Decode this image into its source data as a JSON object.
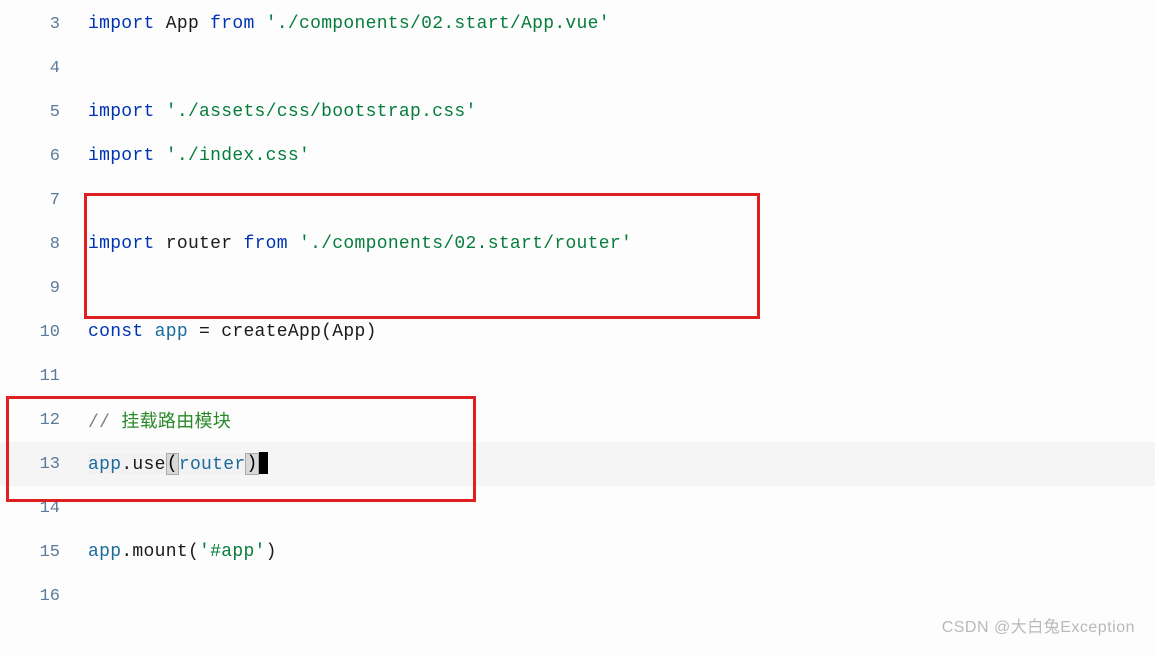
{
  "lines": [
    {
      "num": "3",
      "tokens": [
        {
          "t": "import",
          "c": "tok-keyword"
        },
        {
          "t": " ",
          "c": "tok-default"
        },
        {
          "t": "App",
          "c": "tok-default"
        },
        {
          "t": " ",
          "c": "tok-default"
        },
        {
          "t": "from",
          "c": "tok-keyword"
        },
        {
          "t": " ",
          "c": "tok-default"
        },
        {
          "t": "'./components/02.start/App.vue'",
          "c": "tok-string"
        }
      ]
    },
    {
      "num": "4",
      "tokens": []
    },
    {
      "num": "5",
      "tokens": [
        {
          "t": "import",
          "c": "tok-keyword"
        },
        {
          "t": " ",
          "c": "tok-default"
        },
        {
          "t": "'./assets/css/bootstrap.css'",
          "c": "tok-string"
        }
      ]
    },
    {
      "num": "6",
      "tokens": [
        {
          "t": "import",
          "c": "tok-keyword"
        },
        {
          "t": " ",
          "c": "tok-default"
        },
        {
          "t": "'./index.css'",
          "c": "tok-string"
        }
      ]
    },
    {
      "num": "7",
      "tokens": []
    },
    {
      "num": "8",
      "tokens": [
        {
          "t": "import",
          "c": "tok-keyword"
        },
        {
          "t": " ",
          "c": "tok-default"
        },
        {
          "t": "router",
          "c": "tok-default"
        },
        {
          "t": " ",
          "c": "tok-default"
        },
        {
          "t": "from",
          "c": "tok-keyword"
        },
        {
          "t": " ",
          "c": "tok-default"
        },
        {
          "t": "'./components/02.start/router'",
          "c": "tok-string"
        }
      ]
    },
    {
      "num": "9",
      "tokens": []
    },
    {
      "num": "10",
      "tokens": [
        {
          "t": "const",
          "c": "tok-keyword"
        },
        {
          "t": " ",
          "c": "tok-default"
        },
        {
          "t": "app",
          "c": "tok-ident2"
        },
        {
          "t": " = ",
          "c": "tok-default"
        },
        {
          "t": "createApp",
          "c": "tok-default"
        },
        {
          "t": "(",
          "c": "tok-default"
        },
        {
          "t": "App",
          "c": "tok-default"
        },
        {
          "t": ")",
          "c": "tok-default"
        }
      ]
    },
    {
      "num": "11",
      "tokens": []
    },
    {
      "num": "12",
      "tokens": [
        {
          "t": "// ",
          "c": "tok-comment"
        },
        {
          "t": "挂载路由模块",
          "c": "tok-comment-cn"
        }
      ]
    },
    {
      "num": "13",
      "current": true,
      "tokens": [
        {
          "t": "app",
          "c": "tok-ident2"
        },
        {
          "t": ".",
          "c": "tok-default"
        },
        {
          "t": "use",
          "c": "tok-default"
        },
        {
          "t": "(",
          "c": "bracket-hl"
        },
        {
          "t": "router",
          "c": "tok-ident2"
        },
        {
          "t": ")",
          "c": "bracket-hl"
        },
        {
          "t": "",
          "c": "cursor"
        }
      ]
    },
    {
      "num": "14",
      "tokens": []
    },
    {
      "num": "15",
      "tokens": [
        {
          "t": "app",
          "c": "tok-ident2"
        },
        {
          "t": ".",
          "c": "tok-default"
        },
        {
          "t": "mount",
          "c": "tok-default"
        },
        {
          "t": "(",
          "c": "tok-default"
        },
        {
          "t": "'#app'",
          "c": "tok-string"
        },
        {
          "t": ")",
          "c": "tok-default"
        }
      ]
    },
    {
      "num": "16",
      "tokens": []
    }
  ],
  "watermark": "CSDN @大白兔Exception"
}
